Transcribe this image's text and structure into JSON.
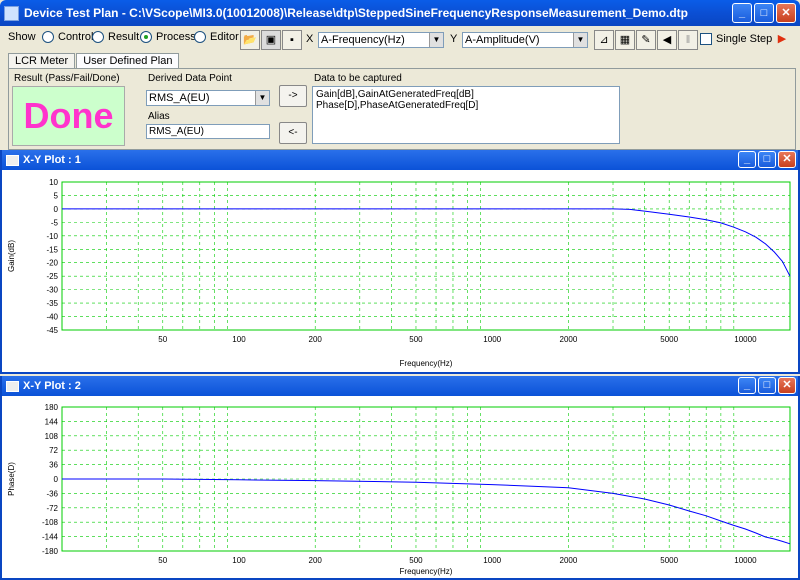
{
  "window": {
    "title": "Device Test Plan - C:\\VScope\\MI3.0(10012008)\\Release\\dtp\\SteppedSineFrequencyResponseMeasurement_Demo.dtp"
  },
  "toolbar": {
    "show_label": "Show",
    "radios": [
      {
        "label": "Control",
        "selected": false
      },
      {
        "label": "Result",
        "selected": false
      },
      {
        "label": "Process",
        "selected": true
      },
      {
        "label": "Editor",
        "selected": false
      }
    ],
    "x_label": "X",
    "x_value": "A-Frequency(Hz)",
    "y_label": "Y",
    "y_value": "A-Amplitude(V)",
    "single_step_label": "Single Step",
    "single_step_checked": false
  },
  "tabs": [
    {
      "label": "LCR Meter",
      "active": false
    },
    {
      "label": "User Defined Plan",
      "active": true
    }
  ],
  "plan": {
    "result_label": "Result (Pass/Fail/Done)",
    "result_value": "Done",
    "derived_label": "Derived Data Point",
    "derived_value": "RMS_A(EU)",
    "alias_label": "Alias",
    "alias_value": "RMS_A(EU)",
    "add_button": "->",
    "remove_button": "<-",
    "capture_label": "Data to be captured",
    "capture_lines": [
      "Gain[dB],GainAtGeneratedFreq[dB]",
      "Phase[D],PhaseAtGeneratedFreq[D]"
    ]
  },
  "plots": [
    {
      "title": "X-Y Plot : 1",
      "chart_data": {
        "type": "line",
        "xlabel": "Frequency(Hz)",
        "ylabel": "Gain(dB)",
        "xscale": "log",
        "xlim": [
          20,
          15000
        ],
        "ylim": [
          -45,
          10
        ],
        "yticks": [
          10,
          5,
          0,
          -5,
          -10,
          -15,
          -20,
          -25,
          -30,
          -35,
          -40,
          -45
        ],
        "xticks": [
          50,
          100,
          200,
          500,
          1000,
          2000,
          5000,
          10000
        ],
        "grid": true,
        "series": [
          {
            "color": "#0000ff",
            "x": [
              20,
              50,
              100,
              200,
              500,
              1000,
              2000,
              3000,
              3500,
              4000,
              5000,
              6000,
              7000,
              8000,
              9000,
              10000,
              11000,
              12000,
              13000,
              14000,
              15000
            ],
            "y": [
              0,
              0,
              0,
              0,
              0,
              0,
              0,
              0,
              -0.2,
              -0.8,
              -2,
              -3,
              -4,
              -5.2,
              -6.8,
              -8.5,
              -10.5,
              -13,
              -16,
              -19.5,
              -25
            ]
          }
        ]
      }
    },
    {
      "title": "X-Y Plot : 2",
      "chart_data": {
        "type": "line",
        "xlabel": "Frequency(Hz)",
        "ylabel": "Phase(D)",
        "xscale": "log",
        "xlim": [
          20,
          15000
        ],
        "ylim": [
          -180,
          180
        ],
        "yticks": [
          180,
          144,
          108,
          72,
          36,
          0,
          -36,
          -72,
          -108,
          -144,
          -180
        ],
        "xticks": [
          50,
          100,
          200,
          500,
          1000,
          2000,
          5000,
          10000
        ],
        "grid": true,
        "series": [
          {
            "color": "#0000ff",
            "x": [
              20,
              50,
              100,
              200,
              500,
              1000,
              2000,
              3000,
              4000,
              5000,
              6000,
              7000,
              8000,
              9000,
              10000,
              11000,
              12000,
              13000,
              14000,
              15000
            ],
            "y": [
              0,
              0,
              -2,
              -4,
              -8,
              -14,
              -22,
              -36,
              -50,
              -65,
              -80,
              -92,
              -105,
              -116,
              -125,
              -135,
              -145,
              -150,
              -156,
              -162
            ]
          }
        ]
      }
    }
  ]
}
